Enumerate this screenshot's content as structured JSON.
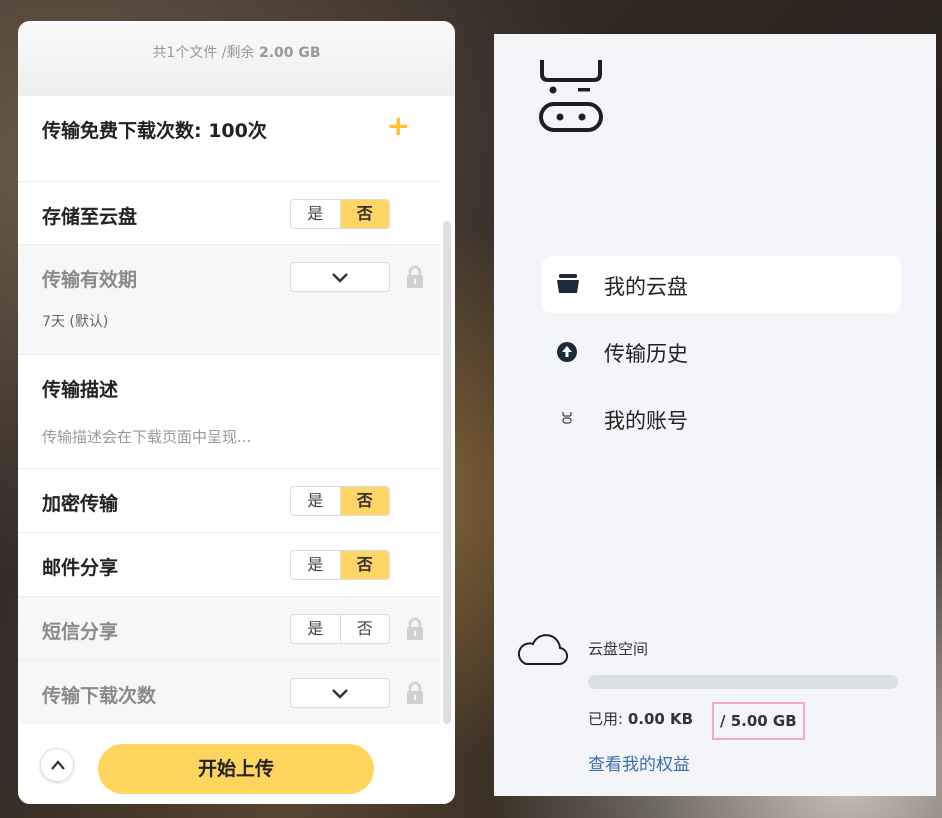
{
  "upload_panel": {
    "file_summary": {
      "count": "共1个文件",
      "sep": " /剩余 ",
      "remaining": "2.00 GB"
    },
    "rows": {
      "free_downloads": {
        "title": "传输免费下载次数: 100次",
        "icon": "plus-icon"
      },
      "save_cloud": {
        "title": "存储至云盘",
        "yes": "是",
        "no": "否",
        "selected": "否"
      },
      "validity": {
        "title": "传输有效期",
        "value": "7天 (默认)",
        "locked": true
      },
      "description": {
        "title": "传输描述",
        "placeholder": "传输描述会在下载页面中呈现..."
      },
      "encrypt": {
        "title": "加密传输",
        "yes": "是",
        "no": "否",
        "selected": "否"
      },
      "email_share": {
        "title": "邮件分享",
        "yes": "是",
        "no": "否",
        "selected": "否"
      },
      "sms_share": {
        "title": "短信分享",
        "yes": "是",
        "no": "否",
        "locked": true
      },
      "download_count": {
        "title": "传输下载次数",
        "locked": true
      }
    },
    "start_button": "开始上传"
  },
  "side_panel": {
    "nav": [
      {
        "label": "我的云盘",
        "icon": "cloud-drive-icon",
        "active": true
      },
      {
        "label": "传输历史",
        "icon": "upload-circle-icon",
        "active": false
      },
      {
        "label": "我的账号",
        "icon": "account-icon",
        "active": false
      }
    ],
    "storage": {
      "title": "云盘空间",
      "used_label": "已用: ",
      "used_value": "0.00 KB",
      "total": "/ 5.00 GB",
      "used_fraction": 0,
      "link": "查看我的权益"
    }
  },
  "colors": {
    "accent": "#ffd55e",
    "highlight": "#f4a8c5",
    "link": "#3a6fb0"
  }
}
